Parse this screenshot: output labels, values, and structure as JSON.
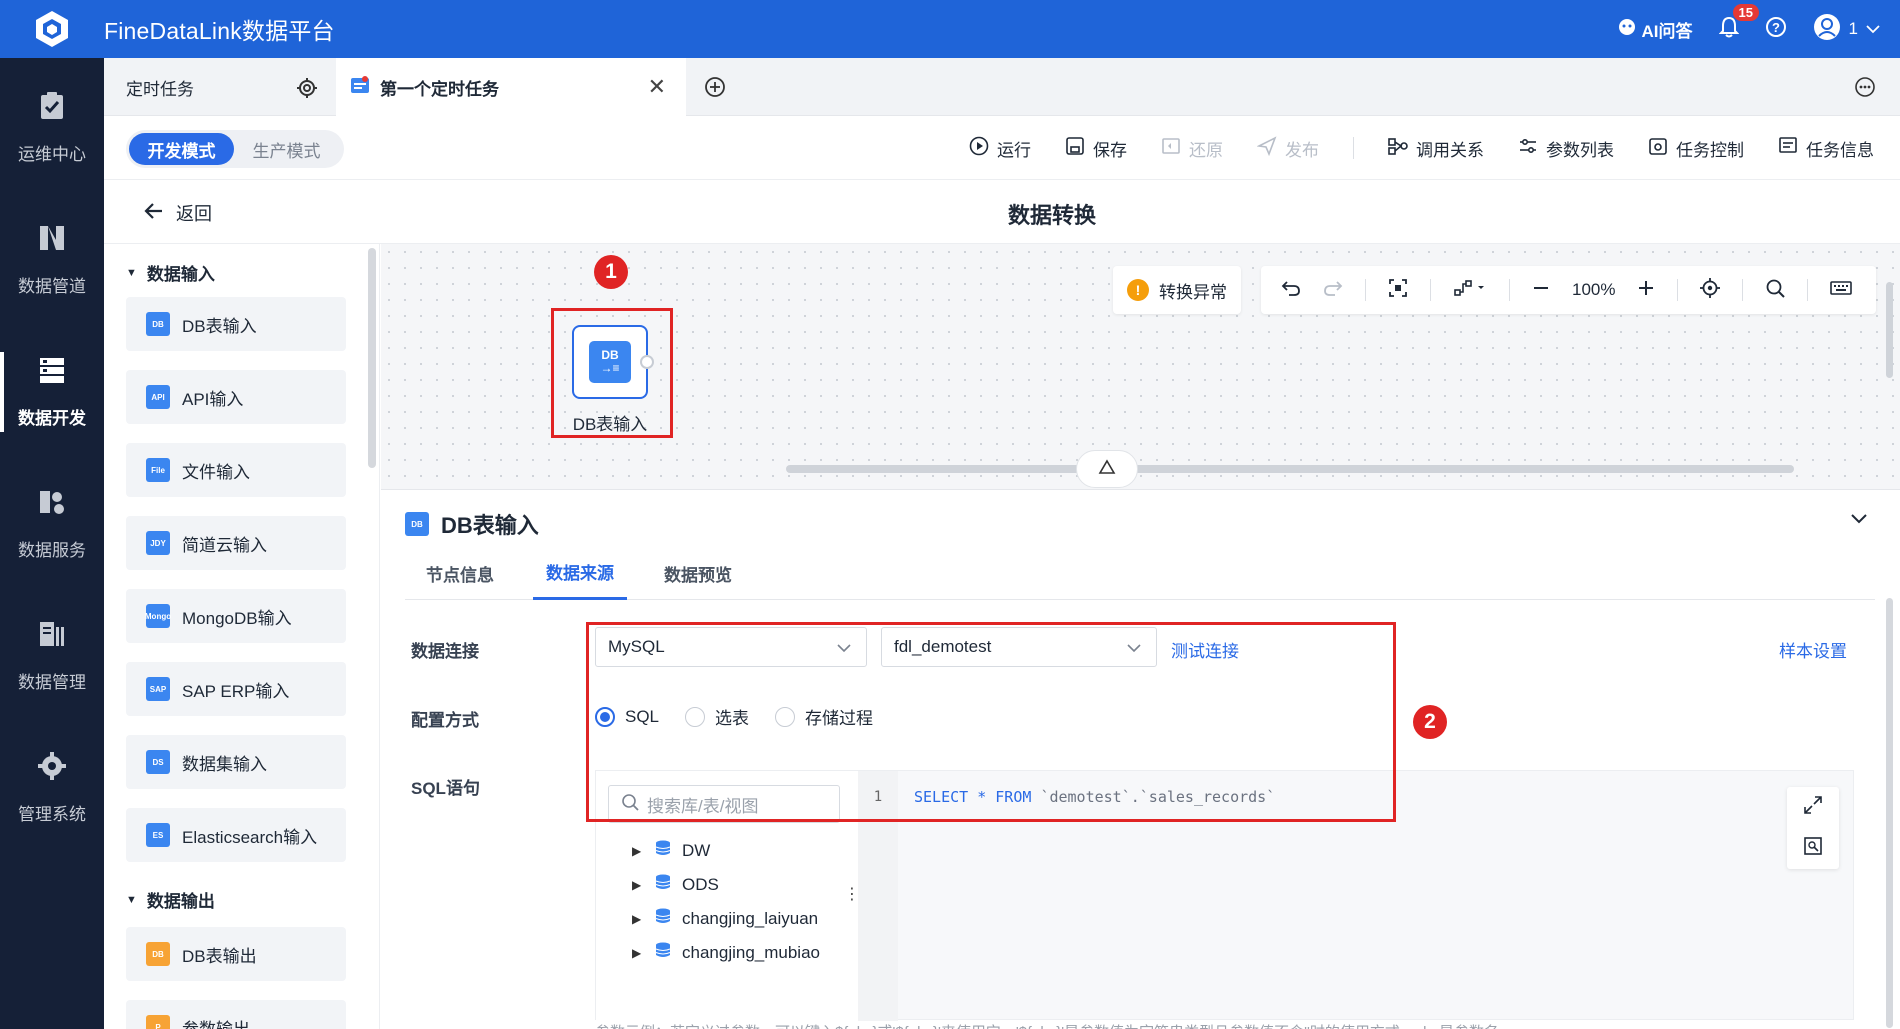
{
  "app": {
    "title": "FineDataLink数据平台",
    "ai_label": "AI问答",
    "notif_count": "15",
    "user_name": "1"
  },
  "leftnav": [
    {
      "label": "运维中心",
      "icon": "clipboard-check-icon"
    },
    {
      "label": "数据管道",
      "icon": "pipeline-icon"
    },
    {
      "label": "数据开发",
      "icon": "dev-icon",
      "active": true
    },
    {
      "label": "数据服务",
      "icon": "service-icon"
    },
    {
      "label": "数据管理",
      "icon": "manage-icon"
    },
    {
      "label": "管理系统",
      "icon": "gear-icon"
    }
  ],
  "tabs": {
    "scheduled": "定时任务",
    "current": "第一个定时任务"
  },
  "modes": {
    "dev": "开发模式",
    "prod": "生产模式"
  },
  "toolbar": {
    "run": "运行",
    "save": "保存",
    "restore": "还原",
    "publish": "发布",
    "call_relation": "调用关系",
    "param_list": "参数列表",
    "task_control": "任务控制",
    "task_info": "任务信息"
  },
  "nav": {
    "back": "返回",
    "page_title": "数据转换"
  },
  "components": {
    "input_group": "数据输入",
    "output_group": "数据输出",
    "inputs": [
      {
        "label": "DB表输入",
        "ico": "DB"
      },
      {
        "label": "API输入",
        "ico": "API"
      },
      {
        "label": "文件输入",
        "ico": "File"
      },
      {
        "label": "简道云输入",
        "ico": "JDY"
      },
      {
        "label": "MongoDB输入",
        "ico": "Mongo"
      },
      {
        "label": "SAP ERP输入",
        "ico": "SAP"
      },
      {
        "label": "数据集输入",
        "ico": "DS"
      },
      {
        "label": "Elasticsearch输入",
        "ico": "ES"
      }
    ],
    "outputs": [
      {
        "label": "DB表输出",
        "ico": "DB"
      },
      {
        "label": "参数输出",
        "ico": "P"
      }
    ]
  },
  "canvas": {
    "node_label": "DB表输入",
    "node_ico": "DB",
    "warning": "转换异常",
    "zoom": "100%",
    "marker1": "1",
    "marker2": "2"
  },
  "config": {
    "title": "DB表输入",
    "tabs": [
      "节点信息",
      "数据来源",
      "数据预览"
    ],
    "labels": {
      "connection": "数据连接",
      "config_mode": "配置方式",
      "sql": "SQL语句"
    },
    "db_type": "MySQL",
    "db_name": "fdl_demotest",
    "test_connection": "测试连接",
    "sample_settings": "样本设置",
    "radios": [
      "SQL",
      "选表",
      "存储过程"
    ],
    "search_placeholder": "搜索库/表/视图",
    "tree": [
      "DW",
      "ODS",
      "changjing_laiyuan",
      "changjing_mubiao"
    ],
    "line_number": "1",
    "sql_kw1": "SELECT * FROM ",
    "sql_str": "`demotest`.`sales_records`",
    "hint": "参数示例：若定义过参数，可以键入${abc}或'${abc}'来使用它，'${abc}'是参数值为字符串类型且参数值不含''时的使用方式，abc是参数名"
  }
}
